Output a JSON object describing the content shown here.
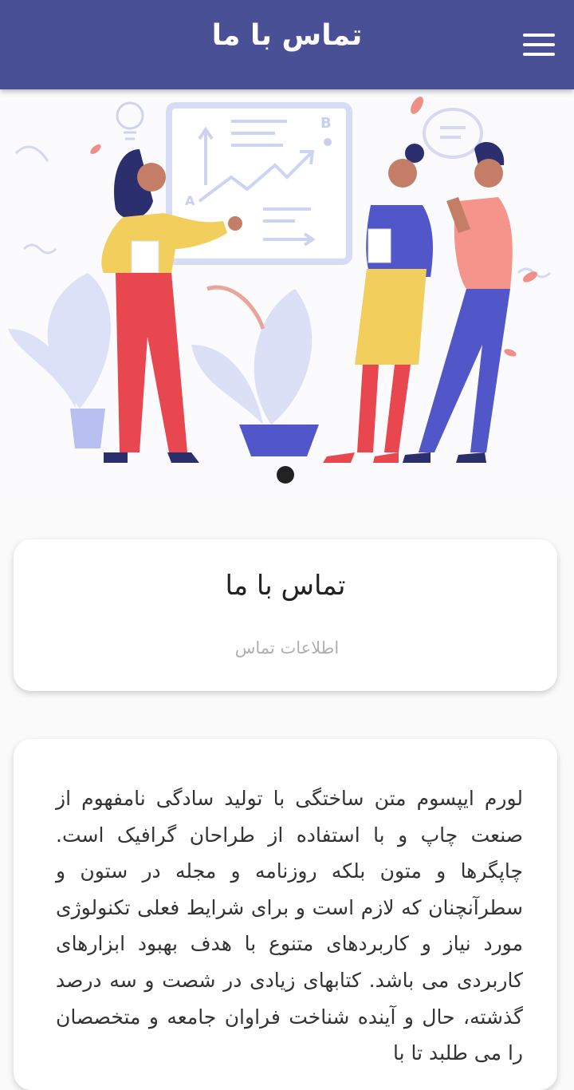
{
  "appbar": {
    "title": "تماس با ما",
    "menu_icon": "menu-icon"
  },
  "hero": {
    "illustration": "team-presentation-illustration",
    "slides_indicator": "carousel-dot"
  },
  "info_card": {
    "title": "تماس با ما",
    "subtitle": "اطلاعات تماس"
  },
  "body_card": {
    "text": "لورم ایپسوم متن ساختگی با تولید سادگی نامفهوم از صنعت چاپ و با استفاده از طراحان گرافیک است. چاپگرها و متون بلکه روزنامه و مجله در ستون و سطرآنچنان که لازم است و برای شرایط فعلی تکنولوژی مورد نیاز و کاربردهای متنوع با هدف بهبود ابزارهای کاربردی می باشد. کتابهای زیادی در شصت و سه درصد گذشته، حال و آینده شناخت فراوان جامعه و متخصصان را می طلبد تا با"
  },
  "colors": {
    "appbar": "#4a5096",
    "accent_red": "#e8474f",
    "accent_blue": "#5157c9",
    "accent_yellow": "#f2ce5c"
  }
}
